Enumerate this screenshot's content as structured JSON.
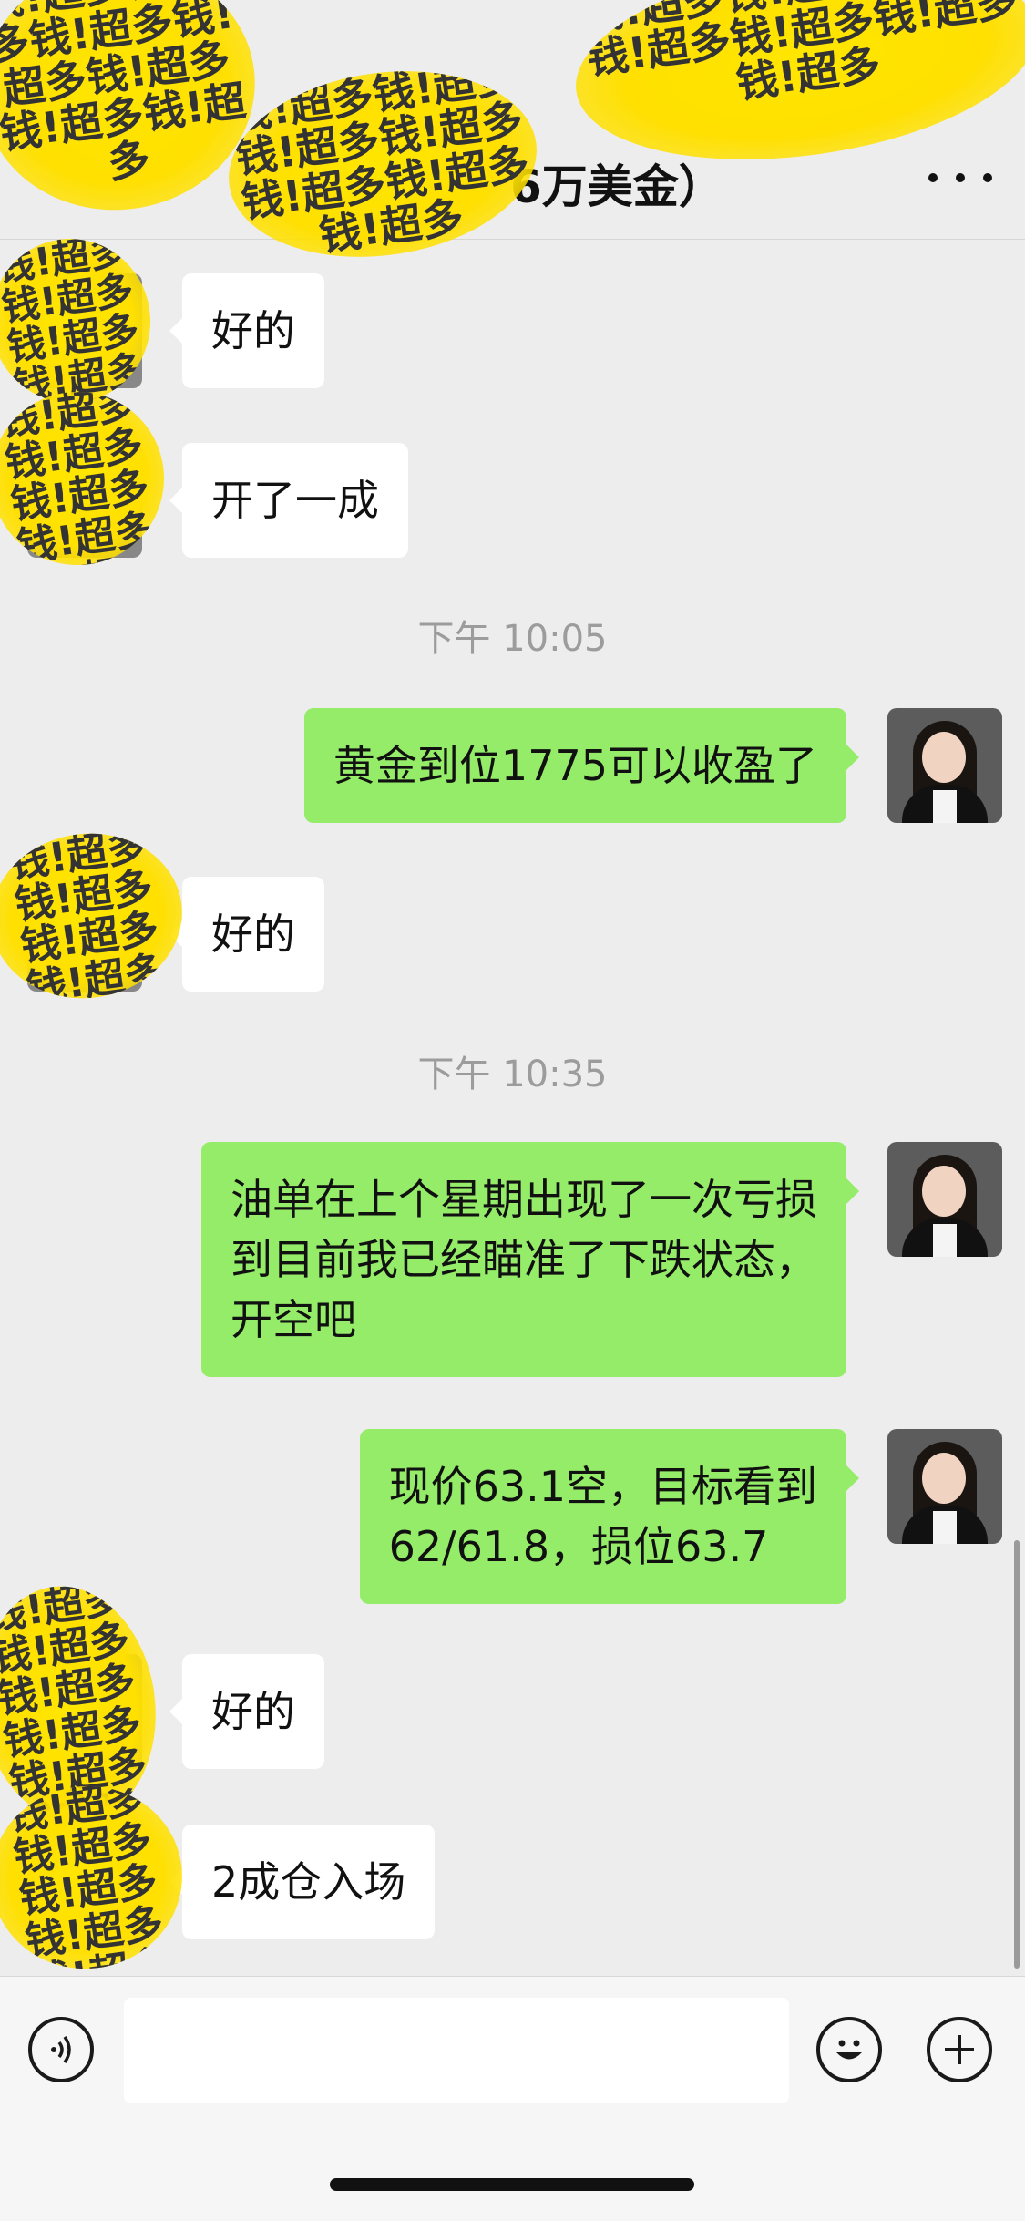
{
  "header": {
    "title_visible": "6万美金）"
  },
  "redaction_text": "钱!超多钱!超多钱!超多钱!超多钱!超多钱!超多钱!超多",
  "messages": [
    {
      "side": "in",
      "text": "好的"
    },
    {
      "side": "in",
      "text": "开了一成"
    },
    {
      "type": "time",
      "text": "下午 10:05"
    },
    {
      "side": "out",
      "text": "黄金到位1775可以收盈了"
    },
    {
      "side": "in",
      "text": "好的"
    },
    {
      "type": "time",
      "text": "下午 10:35"
    },
    {
      "side": "out",
      "text": "油单在上个星期出现了一次亏损\n到目前我已经瞄准了下跌状态，\n开空吧"
    },
    {
      "side": "out",
      "text": "现价63.1空，目标看到\n62/61.8，损位63.7"
    },
    {
      "side": "in",
      "text": "好的"
    },
    {
      "side": "in",
      "text": "2成仓入场"
    }
  ],
  "input": {
    "placeholder": ""
  },
  "icons": {
    "more": "more-dots-icon",
    "voice": "voice-icon",
    "emoji": "emoji-icon",
    "add": "plus-icon"
  },
  "colors": {
    "background": "#ededed",
    "outgoing_bubble": "#95ec69",
    "incoming_bubble": "#ffffff",
    "timestamp": "#9c9c9c",
    "redaction": "#ffe600"
  }
}
